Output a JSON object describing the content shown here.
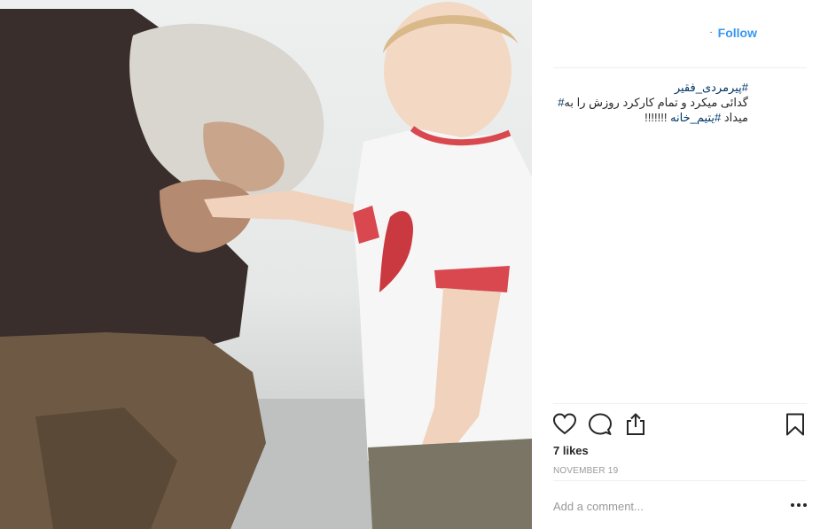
{
  "header": {
    "separator": "·",
    "follow_label": "Follow"
  },
  "caption": {
    "hashtag_1": "#پیرمردی_فقیر",
    "line_2_text": "گدائی میکرد و تمام کارکرد روزش را به",
    "line_2_hash": "#",
    "hashtag_2": "#یتیم_خانه",
    "line_3_text": "میداد",
    "line_3_suffix": "!!!!!!!"
  },
  "actions": {
    "like_icon": "heart-icon",
    "comment_icon": "comment-icon",
    "share_icon": "share-icon",
    "save_icon": "bookmark-icon"
  },
  "likes_text": "7 likes",
  "date_text": "NOVEMBER 19",
  "comment": {
    "placeholder": "Add a comment...",
    "more_icon": "more-options-icon"
  },
  "colors": {
    "follow": "#3897f0",
    "hashtag": "#003569",
    "text": "#262626",
    "muted": "#999999",
    "divider": "#efefef"
  }
}
